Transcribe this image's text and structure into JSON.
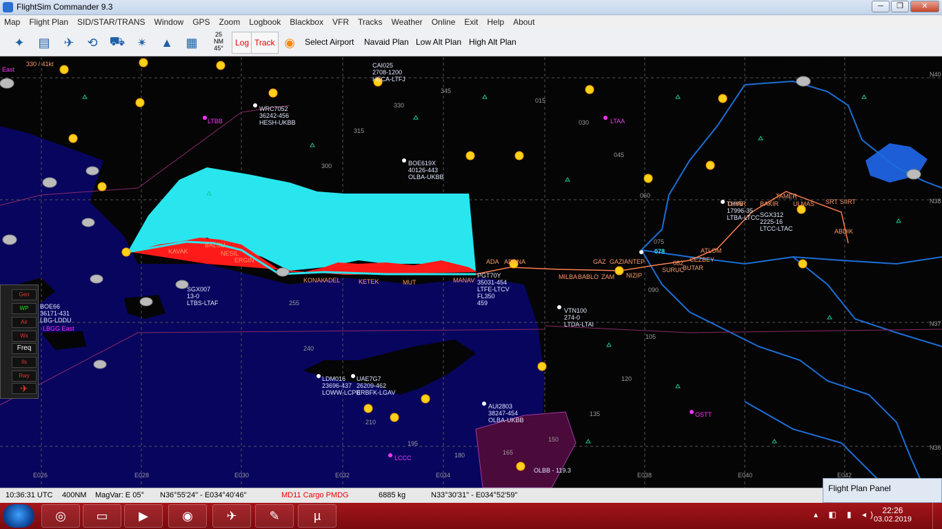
{
  "window": {
    "title": "FlightSim Commander 9.3",
    "minimize": "─",
    "maximize": "❐",
    "close": "✕"
  },
  "menu": [
    "Map",
    "Flight Plan",
    "SID/STAR/TRANS",
    "Window",
    "GPS",
    "Zoom",
    "Logbook",
    "Blackbox",
    "VFR",
    "Tracks",
    "Weather",
    "Online",
    "Exit",
    "Help",
    "About"
  ],
  "toolbar": {
    "nm_value": "25",
    "nm_unit": "NM",
    "angle": "45°",
    "log": "Log",
    "track": "Track",
    "select_airport": "Select Airport",
    "navaid_plan": "Navaid Plan",
    "low_alt_plan": "Low Alt Plan",
    "high_alt_plan": "High Alt Plan"
  },
  "map": {
    "labels": {
      "east": "East",
      "alt_top": "330 / 41kt",
      "ltbb": "LTBB",
      "ltaa": "LTAA",
      "lccc": "LCCC",
      "ostt": "OSTT",
      "lbgg": "LBGG East",
      "ca1025": "CAI025",
      "ca1025_sub": "2708-1200",
      "ca1025_rt": "HECA-LTFJ",
      "wrc": "WRC7052",
      "wrc_sub": "36242-456",
      "wrc_rt": "HESH-UKBB",
      "boe619": "BOE619X",
      "boe619_sub": "40126-443",
      "boe619_rt": "OLBA-UKBB",
      "pgt": "PGT70Y",
      "pgt_sub": "35031-454",
      "pgt_rt": "LTFE-LTCV",
      "fl": "FL350",
      "gs": "459",
      "sgx007": "SGX007",
      "sgx007_sub": "13-0",
      "sgx007_rt": "LTBS-LTAF",
      "boe66": "BOE66",
      "boe66_sub": "36171-431",
      "boe66_rt": "LBG-LDDU",
      "vtn": "VTN100",
      "vtn_sub": "274-0",
      "vtn_rt": "LTDA-LTAI",
      "ldm": "LDM016",
      "ldm_sub": "23696-437",
      "ldm_rt": "LOWW-LCPB",
      "uae": "UAE7G7",
      "uae_sub": "26209-462",
      "uae_rt": "ERBFK-LGAV",
      "aui": "AUI2803",
      "aui_sub": "38247-454",
      "aui_rt": "OLBA-UKBB",
      "thy": "THY5",
      "thy_sub": "17996-35",
      "thy_rt": "LTBA-LTCC",
      "sgx312": "SGX312",
      "sgx312_sub": "2225-16",
      "sgx312_rt": "LTCC-LTAC",
      "olbb": "OLBB - 119.3",
      "freq_078": "078"
    },
    "waypoints": [
      "KAVAK",
      "BALSU",
      "NESIL",
      "ERGIN",
      "KONAK",
      "ADEL",
      "KETEK",
      "MUT",
      "MANAV",
      "ADANA",
      "ADA",
      "MILBA",
      "BABLO",
      "ZAM",
      "GAZ",
      "GAZIANTEP",
      "NIZIP",
      "SURUC",
      "BUTAR",
      "CEZBEY",
      "ATLOM",
      "DIYAR",
      "BAKIR",
      "TAMER",
      "ULMAS",
      "SRT",
      "SIIRT",
      "ABDIK",
      "082"
    ],
    "alts": [
      "345",
      "330",
      "315",
      "300",
      "015",
      "030",
      "045",
      "060",
      "075",
      "090",
      "105",
      "120",
      "135",
      "150",
      "165",
      "180",
      "195",
      "210",
      "240",
      "255"
    ],
    "grid_lon": [
      "E026",
      "E028",
      "E030",
      "E032",
      "E034",
      "E038",
      "E040",
      "E042"
    ],
    "grid_lat": [
      "N38",
      "N37",
      "N36",
      "N40"
    ]
  },
  "side_panel": {
    "gen": "Gen",
    "wp": "WP",
    "air": "Air",
    "wx": "Wx",
    "freq": "Freq",
    "ils": "Ils",
    "rwy": "Rwy"
  },
  "status": {
    "time": "10:36:31 UTC",
    "range": "400NM",
    "magvar": "MagVar: E 05°",
    "pos1": "N36°55'24\" - E034°40'46\"",
    "aircraft": "MD11 Cargo PMDG",
    "weight": "6885 kg",
    "pos2": "N33°30'31\" - E034°52'59\""
  },
  "fpp": {
    "title": "Flight Plan Panel"
  },
  "tray": {
    "time": "22:26",
    "date": "03.02.2019"
  },
  "colors": {
    "land": "#050505",
    "sea": "#08055e",
    "route": "#ff7f50",
    "terrain": "#29e6ee",
    "terrain_peak": "#ff1a1a",
    "border": "#1b6fd6"
  }
}
